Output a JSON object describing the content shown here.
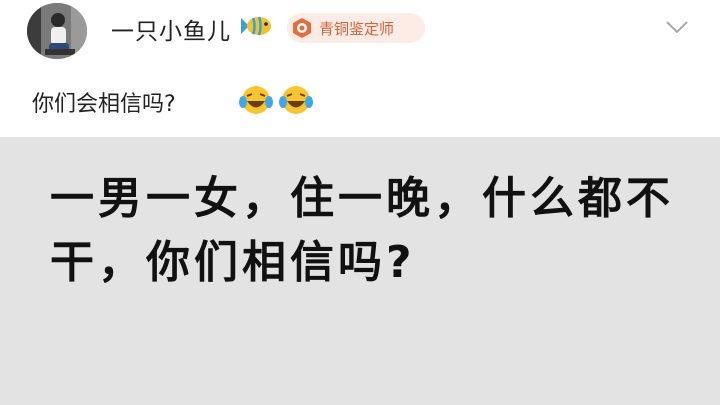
{
  "post": {
    "username": "一只小鱼儿",
    "badge_label": "青铜鉴定师",
    "text": "你们会相信吗?",
    "image_caption": "一男一女，住一晚，什么都不干，你们相信吗?"
  },
  "icons": {
    "avatar": "avatar-photo",
    "username_decoration": "fish-icon",
    "badge": "bronze-medal-icon",
    "menu": "chevron-down-icon",
    "emoji": "laughing-tears-emoji"
  },
  "colors": {
    "badge_text": "#d2643c",
    "badge_background": "#fdebe6",
    "image_background": "#e3e3e3"
  }
}
